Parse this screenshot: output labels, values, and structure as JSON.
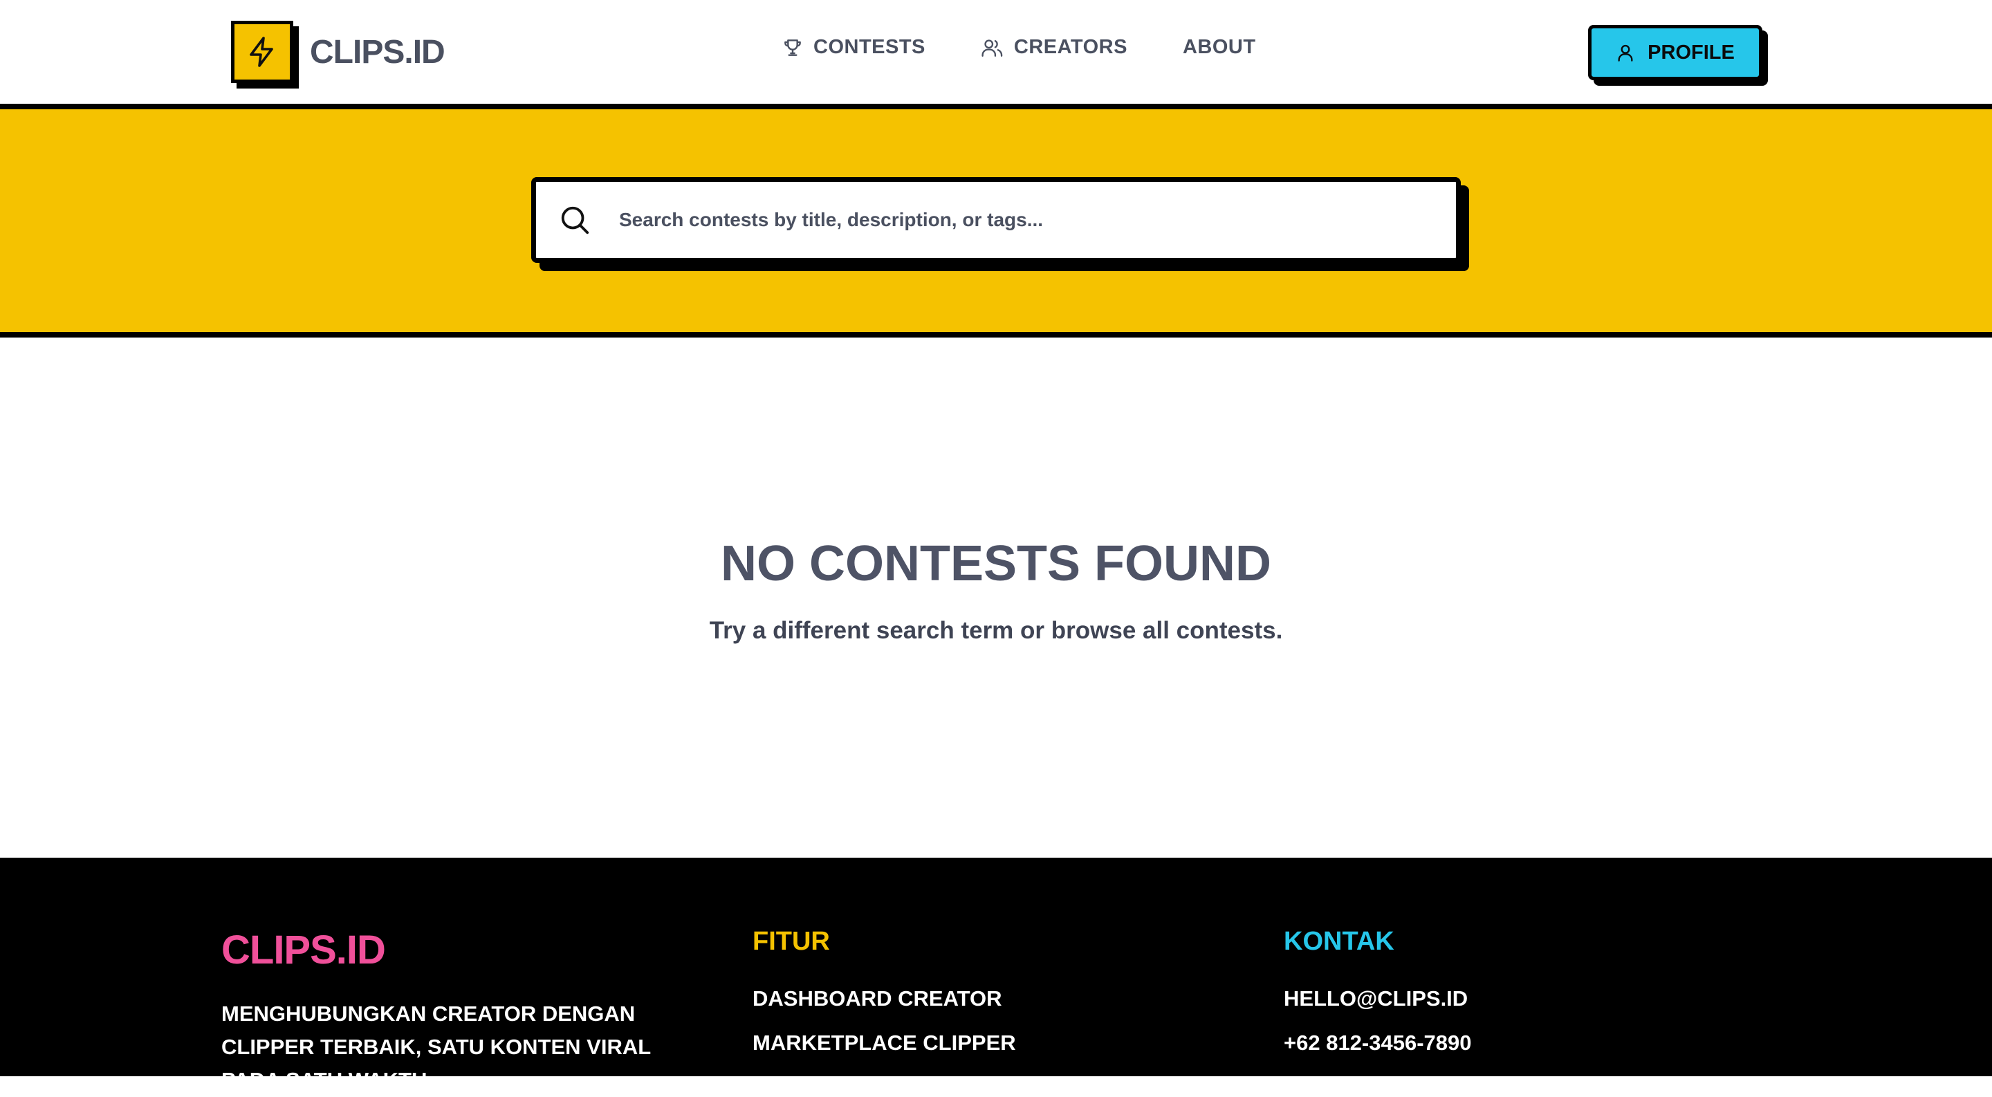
{
  "header": {
    "logo_text": "CLIPS.ID",
    "nav": [
      {
        "label": "CONTESTS",
        "icon": "trophy-icon"
      },
      {
        "label": "CREATORS",
        "icon": "users-icon"
      },
      {
        "label": "ABOUT",
        "icon": ""
      }
    ],
    "profile_label": "PROFILE"
  },
  "search": {
    "placeholder": "Search contests by title, description, or tags...",
    "value": ""
  },
  "empty_state": {
    "title": "NO CONTESTS FOUND",
    "subtitle": "Try a different search term or browse all contests."
  },
  "footer": {
    "brand": "CLIPS.ID",
    "tagline": "MENGHUBUNGKAN CREATOR DENGAN CLIPPER TERBAIK, SATU KONTEN VIRAL PADA SATU WAKTU",
    "fitur": {
      "heading": "FITUR",
      "links": [
        "DASHBOARD CREATOR",
        "MARKETPLACE CLIPPER"
      ]
    },
    "kontak": {
      "heading": "KONTAK",
      "links": [
        "HELLO@CLIPS.ID",
        "+62 812-3456-7890"
      ]
    }
  },
  "colors": {
    "brand_yellow": "#f5c200",
    "brand_cyan": "#26c6ea",
    "brand_pink": "#f0509a",
    "text_gray": "#4a5060"
  }
}
